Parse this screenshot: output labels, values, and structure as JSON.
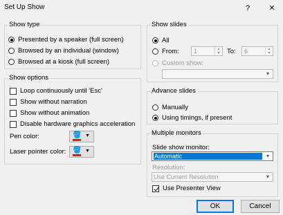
{
  "window": {
    "title": "Set Up Show",
    "help": "?",
    "close": "✕"
  },
  "show_type": {
    "legend": "Show type",
    "options": [
      {
        "label": "Presented by a speaker (full screen)",
        "selected": true
      },
      {
        "label": "Browsed by an individual (window)",
        "selected": false
      },
      {
        "label": "Browsed at a kiosk (full screen)",
        "selected": false
      }
    ]
  },
  "show_options": {
    "legend": "Show options",
    "checks": [
      {
        "label": "Loop continuously until 'Esc'",
        "checked": false
      },
      {
        "label": "Show without narration",
        "checked": false
      },
      {
        "label": "Show without animation",
        "checked": false
      },
      {
        "label": "Disable hardware graphics acceleration",
        "checked": false
      }
    ],
    "pen_color_label": "Pen color:",
    "laser_color_label": "Laser pointer color:",
    "pen_color": "#e81123",
    "laser_color": "#e81123"
  },
  "show_slides": {
    "legend": "Show slides",
    "all_label": "All",
    "from_label": "From:",
    "from_value": "1",
    "to_label": "To:",
    "to_value": "6",
    "custom_label": "Custom show:",
    "custom_value": ""
  },
  "advance_slides": {
    "legend": "Advance slides",
    "manually_label": "Manually",
    "timings_label": "Using timings, if present"
  },
  "monitors": {
    "legend": "Multiple monitors",
    "monitor_label": "Slide show monitor:",
    "monitor_value": "Automatic",
    "resolution_label": "Resolution:",
    "resolution_value": "Use Current Resolution",
    "presenter_view_label": "Use Presenter View",
    "presenter_view_checked": true
  },
  "buttons": {
    "ok": "OK",
    "cancel": "Cancel"
  },
  "colors": {
    "accent": "#0078d7",
    "background": "#f0f0f0",
    "disabled_text": "#a0a0a0"
  }
}
